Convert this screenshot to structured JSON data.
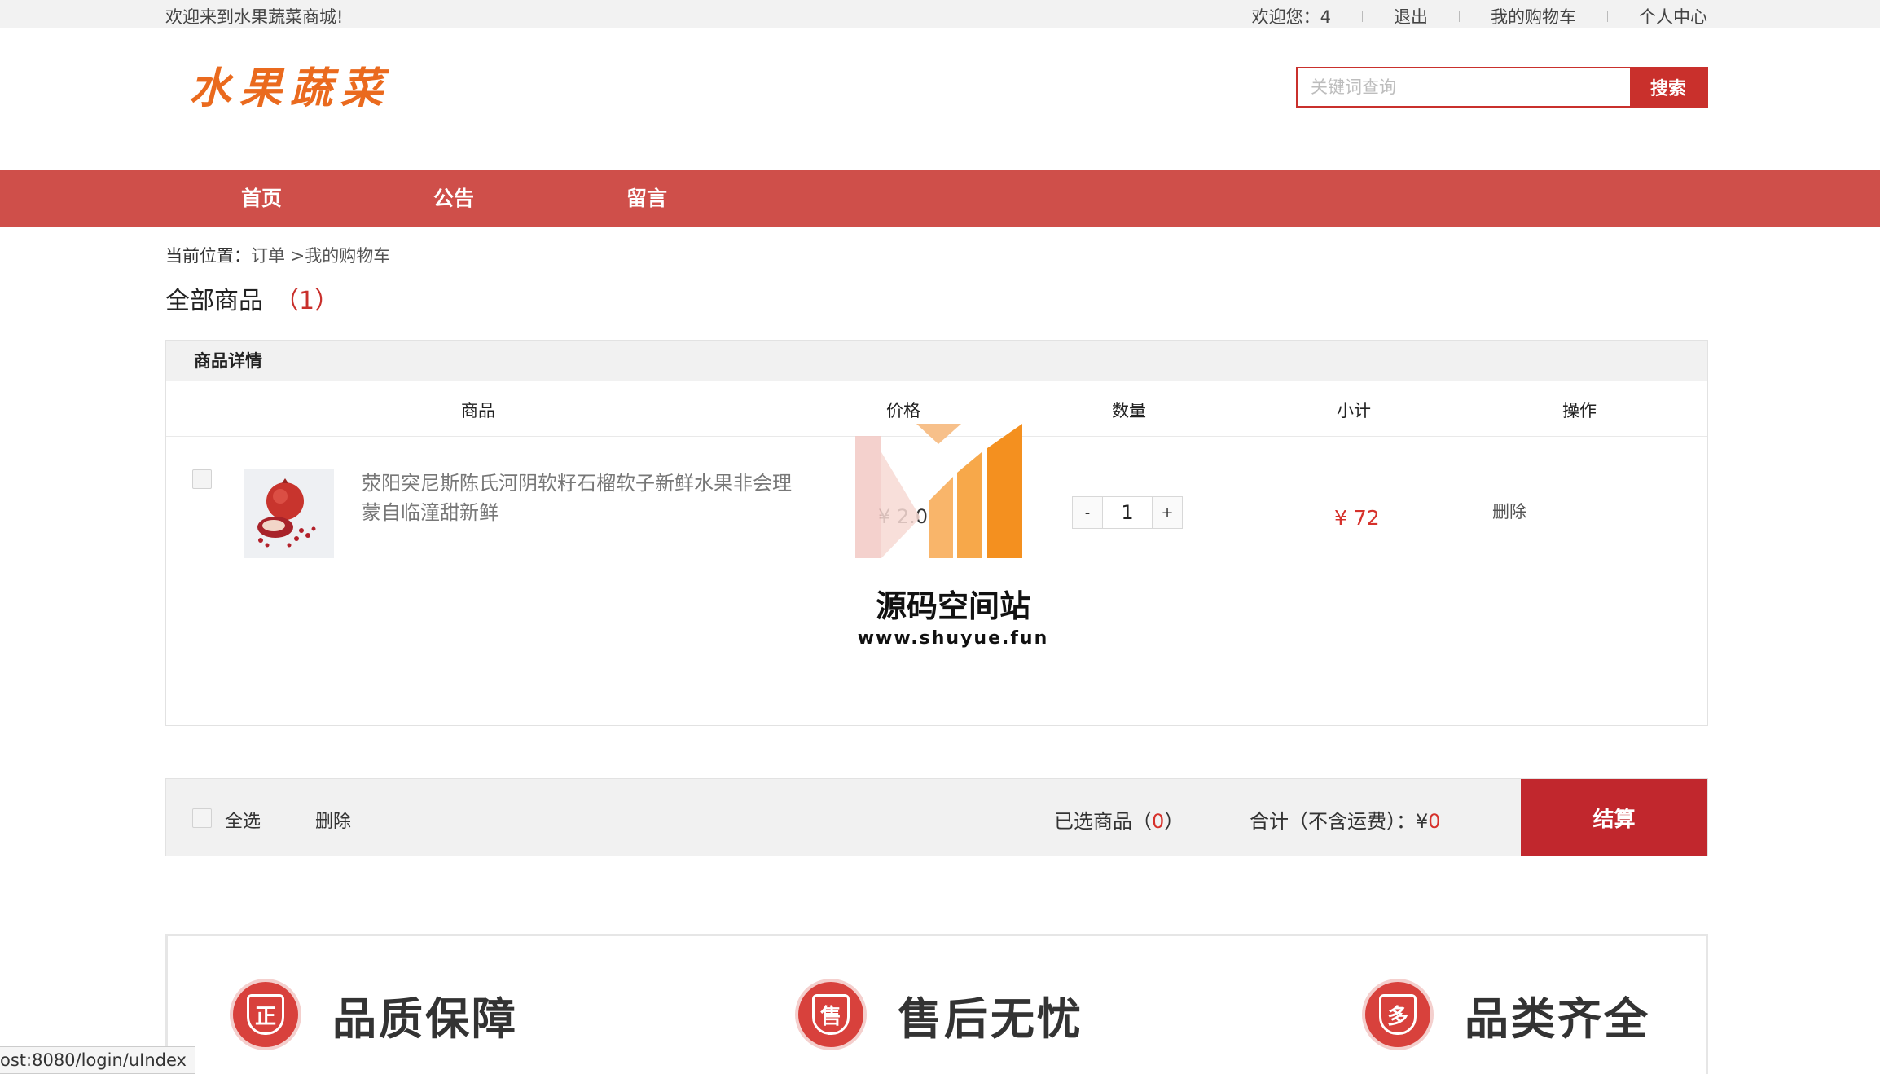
{
  "topbar": {
    "welcome": "欢迎来到水果蔬菜商城!",
    "greeting": "欢迎您：4",
    "logout": "退出",
    "cart": "我的购物车",
    "profile": "个人中心"
  },
  "header": {
    "logo": "水果蔬菜",
    "search_placeholder": "关键词查询",
    "search_button": "搜索"
  },
  "nav": {
    "items": [
      "首页",
      "公告",
      "留言"
    ]
  },
  "breadcrumb": {
    "label": "当前位置：",
    "path": "订单 >我的购物车"
  },
  "page_title": {
    "text": "全部商品",
    "count": "（1）"
  },
  "cart": {
    "section_title": "商品详情",
    "columns": [
      "商品",
      "价格",
      "数量",
      "小计",
      "操作"
    ],
    "items": [
      {
        "name": "荥阳突尼斯陈氏河阴软籽石榴软子新鲜水果非会理蒙自临潼甜新鲜",
        "price": "¥ 2.0",
        "quantity": "1",
        "subtotal": "¥ 72",
        "action": "删除",
        "thumbnail": "pomegranate-image"
      }
    ],
    "stepper": {
      "minus": "-",
      "plus": "+"
    }
  },
  "footer_bar": {
    "select_all": "全选",
    "delete": "删除",
    "selected_label": "已选商品（",
    "selected_count": "0",
    "selected_suffix": "）",
    "total_label": "合计（不含运费）：",
    "total_currency": "¥",
    "total_value": "0",
    "checkout": "结算"
  },
  "guarantees": [
    {
      "icon": "正",
      "label": "品质保障"
    },
    {
      "icon": "售",
      "label": "售后无忧"
    },
    {
      "icon": "多",
      "label": "品类齐全"
    }
  ],
  "status_url": "ost:8080/login/uIndex",
  "watermark": {
    "title": "源码空间站",
    "url": "www.shuyue.fun"
  },
  "colors": {
    "brand_red": "#cf4f4a",
    "accent_red": "#c9302c",
    "logo_orange": "#ea6a1e"
  }
}
